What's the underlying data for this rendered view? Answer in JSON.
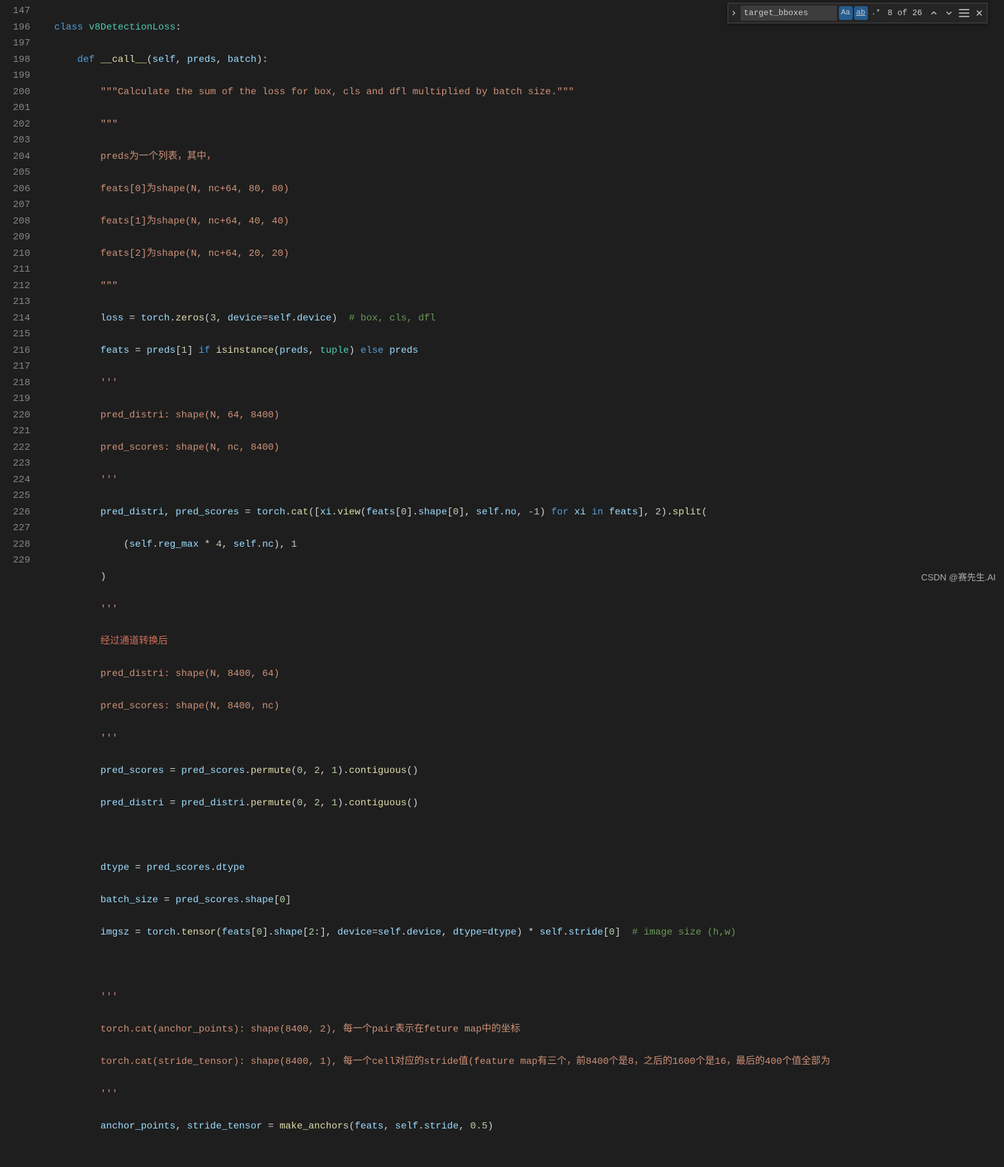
{
  "search": {
    "value": "target_bboxes",
    "case_sensitive_label": "Aa",
    "whole_word_label": "ab",
    "regex_label": ".*",
    "result_count": "8 of 26"
  },
  "watermark": "CSDN @赛先生.AI",
  "gutter": [
    "147",
    "196",
    "197",
    "198",
    "199",
    "200",
    "201",
    "202",
    "203",
    "204",
    "205",
    "206",
    "207",
    "208",
    "209",
    "210",
    "211",
    "212",
    "213",
    "214",
    "215",
    "216",
    "217",
    "218",
    "219",
    "220",
    "221",
    "222",
    "223",
    "224",
    "225",
    "226",
    "227",
    "228",
    "229",
    ""
  ],
  "code": {
    "l147": {
      "kw1": "class",
      "cls": "v8DetectionLoss",
      "p": ":"
    },
    "l196": {
      "kw1": "def",
      "fn": "__call__",
      "p1": "(",
      "self": "self",
      "c1": ", ",
      "a1": "preds",
      "c2": ", ",
      "a2": "batch",
      "p2": "):"
    },
    "l197": {
      "s": "\"\"\"Calculate the sum of the loss for box, cls and dfl multiplied by batch size.\"\"\""
    },
    "l198": {
      "s": "\"\"\""
    },
    "l199": {
      "s": "preds为一个列表，其中，"
    },
    "l200": {
      "s": "feats[0]为shape(N, nc+64, 80, 80)"
    },
    "l201": {
      "s": "feats[1]为shape(N, nc+64, 40, 40)"
    },
    "l202": {
      "s": "feats[2]为shape(N, nc+64, 20, 20)"
    },
    "l203": {
      "s": "\"\"\""
    },
    "l204": {
      "v1": "loss",
      "op": " = ",
      "v2": "torch",
      "d": ".",
      "fn": "zeros",
      "p1": "(",
      "n1": "3",
      "c": ", ",
      "a1": "device",
      "eq": "=",
      "self": "self",
      "d2": ".",
      "attr": "device",
      "p2": ")  ",
      "cmt": "# box, cls, dfl"
    },
    "l205": {
      "v1": "feats",
      "op": " = ",
      "v2": "preds",
      "p1": "[",
      "n1": "1",
      "p2": "] ",
      "kw1": "if",
      "sp1": " ",
      "fn": "isinstance",
      "p3": "(",
      "v3": "preds",
      "c": ", ",
      "bi": "tuple",
      "p4": ") ",
      "kw2": "else",
      "sp2": " ",
      "v4": "preds"
    },
    "l206": {
      "s": "'''"
    },
    "l207": {
      "s": "pred_distri: shape(N, 64, 8400)"
    },
    "l208": {
      "s": "pred_scores: shape(N, nc, 8400)"
    },
    "l209": {
      "s": "'''"
    },
    "l210_a": {
      "v1": "pred_distri",
      "c1": ", ",
      "v2": "pred_scores",
      "op": " = ",
      "v3": "torch",
      "d1": ".",
      "fn1": "cat",
      "p1": "([",
      "v4": "xi",
      "d2": ".",
      "fn2": "view",
      "p2": "(",
      "v5": "feats",
      "p3": "[",
      "n1": "0",
      "p4": "].",
      "attr1": "shape",
      "p5": "[",
      "n2": "0",
      "p6": "], ",
      "self": "self",
      "d3": ".",
      "attr2": "no",
      "c2": ", ",
      "n3": "-1",
      "p7": ") ",
      "kw1": "for",
      "sp1": " ",
      "v6": "xi",
      "sp2": " ",
      "kw2": "in",
      "sp3": " ",
      "v7": "feats",
      "p8": "], ",
      "n4": "2",
      "p9": ").",
      "fn3": "split",
      "p10": "("
    },
    "l211": {
      "p1": "(",
      "self1": "self",
      "d1": ".",
      "attr1": "reg_max",
      "op1": " * ",
      "n1": "4",
      "c1": ", ",
      "self2": "self",
      "d2": ".",
      "attr2": "nc",
      "p2": "), ",
      "n2": "1"
    },
    "l212": {
      "p": ")"
    },
    "l213": {
      "s": "'''"
    },
    "l214": {
      "s": "经过通道转换后"
    },
    "l215": {
      "s": "pred_distri: shape(N, 8400, 64)"
    },
    "l216": {
      "s": "pred_scores: shape(N, 8400, nc)"
    },
    "l217": {
      "s": "'''"
    },
    "l218": {
      "v1": "pred_scores",
      "op": " = ",
      "v2": "pred_scores",
      "d1": ".",
      "fn1": "permute",
      "p1": "(",
      "n1": "0",
      "c1": ", ",
      "n2": "2",
      "c2": ", ",
      "n3": "1",
      "p2": ").",
      "fn2": "contiguous",
      "p3": "()"
    },
    "l219": {
      "v1": "pred_distri",
      "op": " = ",
      "v2": "pred_distri",
      "d1": ".",
      "fn1": "permute",
      "p1": "(",
      "n1": "0",
      "c1": ", ",
      "n2": "2",
      "c2": ", ",
      "n3": "1",
      "p2": ").",
      "fn2": "contiguous",
      "p3": "()"
    },
    "l221": {
      "v1": "dtype",
      "op": " = ",
      "v2": "pred_scores",
      "d": ".",
      "attr": "dtype"
    },
    "l222": {
      "v1": "batch_size",
      "op": " = ",
      "v2": "pred_scores",
      "d": ".",
      "attr": "shape",
      "p1": "[",
      "n1": "0",
      "p2": "]"
    },
    "l223": {
      "v1": "imgsz",
      "op": " = ",
      "v2": "torch",
      "d1": ".",
      "fn": "tensor",
      "p1": "(",
      "v3": "feats",
      "p2": "[",
      "n1": "0",
      "p3": "].",
      "attr1": "shape",
      "p4": "[",
      "n2": "2",
      "p5": ":], ",
      "a1": "device",
      "eq1": "=",
      "self1": "self",
      "d2": ".",
      "attr2": "device",
      "c1": ", ",
      "a2": "dtype",
      "eq2": "=",
      "v4": "dtype",
      "p6": ") * ",
      "self2": "self",
      "d3": ".",
      "attr3": "stride",
      "p7": "[",
      "n3": "0",
      "p8": "]  ",
      "cmt": "# image size (h,w)"
    },
    "l225": {
      "s": "'''"
    },
    "l226": {
      "s": "torch.cat(anchor_points): shape(8400, 2), 每一个pair表示在feture map中的坐标"
    },
    "l227": {
      "s": "torch.cat(stride_tensor): shape(8400, 1), 每一个cell对应的stride值(feature map有三个，前8400个是8，之后的1600个是16，最后的400个值全部为"
    },
    "l228": {
      "s": "'''"
    },
    "l229": {
      "v1": "anchor_points",
      "c1": ", ",
      "v2": "stride_tensor",
      "op": " = ",
      "fn": "make_anchors",
      "p1": "(",
      "v3": "feats",
      "c2": ", ",
      "self": "self",
      "d": ".",
      "attr": "stride",
      "c3": ", ",
      "n1": "0.5",
      "p2": ")"
    }
  }
}
